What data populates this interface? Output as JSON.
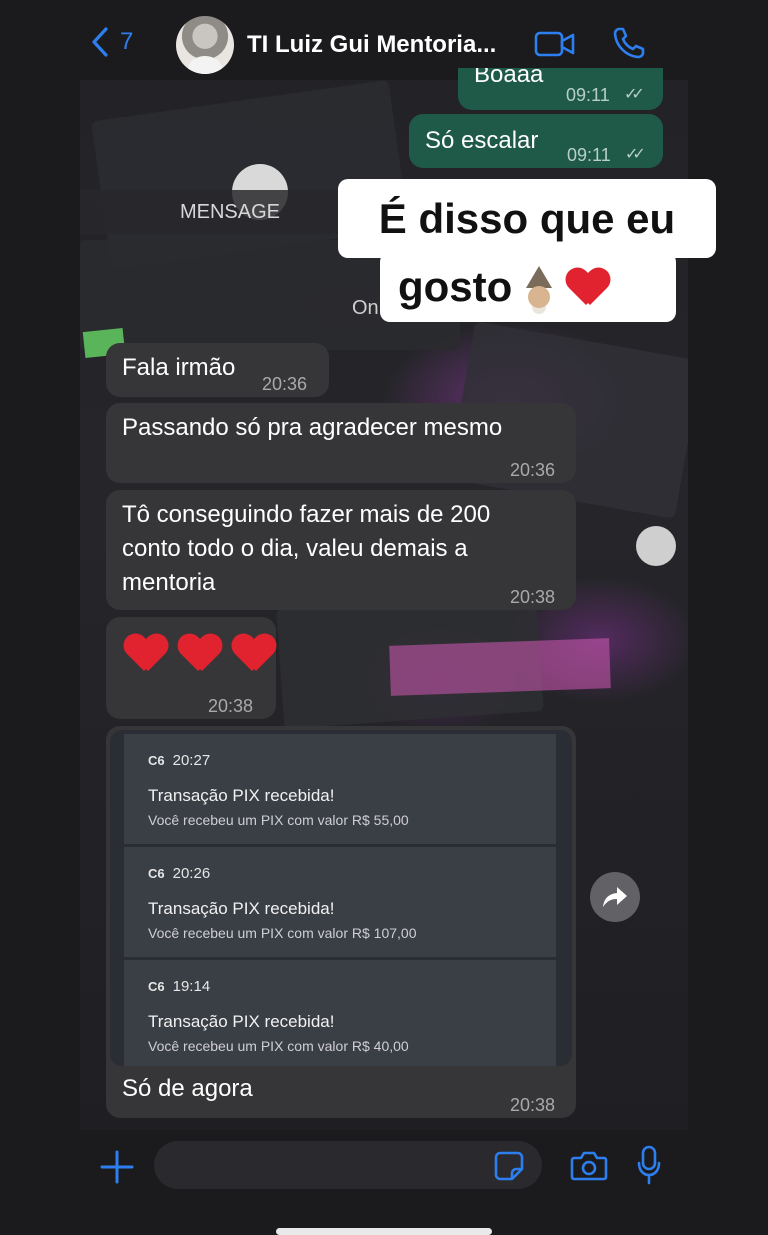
{
  "header": {
    "back_count": "7",
    "chat_title": "TI Luiz Gui Mentoria..."
  },
  "system": {
    "banner": "MENSAGE",
    "online_pill": "On"
  },
  "sticker": {
    "line1": "É disso que eu",
    "line2": "gosto",
    "emojis": [
      "wizard",
      "red-heart"
    ]
  },
  "messages": [
    {
      "dir": "out",
      "text": "Boaaa",
      "time": "09:11"
    },
    {
      "dir": "out",
      "text": "Só escalar",
      "time": "09:11"
    },
    {
      "dir": "in",
      "text": "Fala irmão",
      "time": "20:36"
    },
    {
      "dir": "in",
      "text": "Passando só pra agradecer mesmo",
      "time": "20:36"
    },
    {
      "dir": "in",
      "text_lines": [
        "Tô conseguindo fazer mais de 200",
        "conto todo o dia, valeu demais a",
        "mentoria"
      ],
      "time": "20:38"
    },
    {
      "dir": "in",
      "text": "❤️❤️❤️",
      "time": "20:38"
    },
    {
      "dir": "in",
      "text": "Só de agora",
      "time": "20:38"
    }
  ],
  "pix": [
    {
      "bank": "C6",
      "time": "20:27",
      "title": "Transação PIX recebida!",
      "body": "Você recebeu um PIX com valor R$ 55,00"
    },
    {
      "bank": "C6",
      "time": "20:26",
      "title": "Transação PIX recebida!",
      "body": "Você recebeu um PIX com valor R$ 107,00"
    },
    {
      "bank": "C6",
      "time": "19:14",
      "title": "Transação PIX recebida!",
      "body": "Você recebeu um PIX com valor R$ 40,00"
    }
  ],
  "colors": {
    "accent": "#2d7ff0",
    "bubble_in": "#363638",
    "bubble_out": "#1f5a48",
    "heart": "#e0232f"
  }
}
